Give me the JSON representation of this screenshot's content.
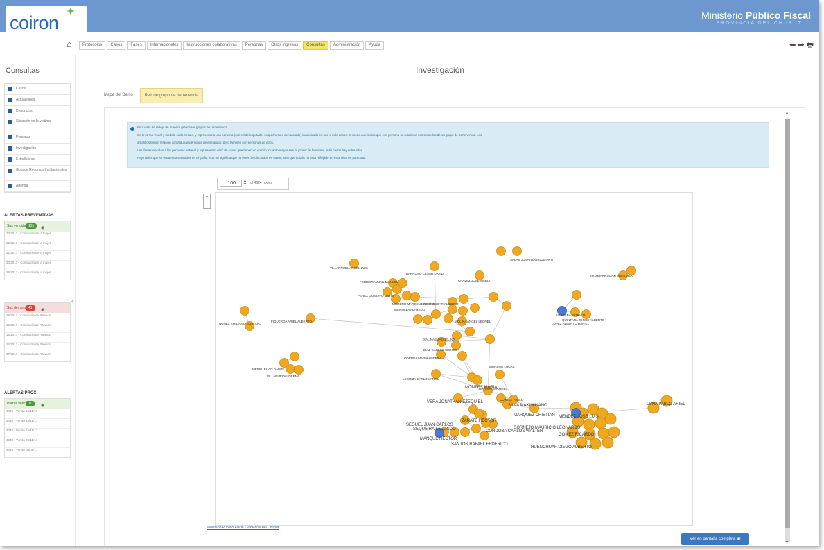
{
  "app": {
    "logo": "coiron",
    "ministry_prefix": "Ministerio ",
    "ministry_bold": "Público Fiscal",
    "ministry_sub": "PROVINCIA DEL CHUBUT"
  },
  "nav": {
    "menu": [
      "Protocolos",
      "Casos",
      "Fases",
      "Internacionales",
      "Instrucciones colaborativas",
      "Personas",
      "Otros ingresos",
      "Consultas",
      "Administración",
      "Ayuda"
    ],
    "active": "Consultas",
    "right_icons": "⬅ ➡ 🖶"
  },
  "sidebar": {
    "title": "Consultas",
    "items": [
      "Casos",
      "Actuaciones",
      "Denuncias",
      "Situación de la víctima",
      "Personas",
      "Investigación",
      "Estadísticas",
      "Guía de Recursos Institucionales",
      "Agenda"
    ],
    "alertas_title": "ALERTAS PREVENTIVAS",
    "sus_vencidas": {
      "label": "Sus vencidas",
      "count": "131"
    },
    "sus_vencidas_items": [
      "33/2017 - Comisaría de la mujer",
      "32/2017 - Comisaría de la mujer",
      "31/2017 - Comisaría de la mujer",
      "30/2017 - Comisaría de la mujer",
      "29/2017 - Comisaría de la mujer"
    ],
    "sus_demoradas": {
      "label": "Sus demoradas",
      "count": "41"
    },
    "sus_demoradas_items": [
      "28/2017 - Comisaría de Rawson",
      "15/2017 - Comisaría de Rawson",
      "15/2017 - Comisaría de Rawson",
      "14/2017 - Comisaría de Rawson",
      "07/2017 - Comisaría de Rawson"
    ],
    "alertas_prox": "ALERTAS PROX",
    "plazos": {
      "label": "Plazos vencidos",
      "count": "11"
    },
    "plazos_items": [
      "4409 - Vcmto 15/11/17",
      "4446 - Vcmto 15/11/17",
      "4346 - Vcmto 15/11/17",
      "4348 - Vcmto 08/11/17",
      "4385 - Vcmto 04/09/17"
    ]
  },
  "page": {
    "title": "Investigación",
    "tabs": [
      "Mapa del Delito",
      "Red de grupo de pertenencia"
    ],
    "active_tab": "Red de grupo de pertenencia"
  },
  "info": {
    "lines": [
      "Esta vista de refleja de manera gráfica los grupos de pertenencia.",
      "Se la forma visual y modela cada círculo, y representa a una persona (con rol de imputado, sospechoso o denunciado) involucrada en uno o más casos. El modo que indica que esa persona se relaciona con todos los de su grupo de pertenencia. Los",
      "amarillos tienen relación con algunas personas de ese grupo, pero también con personas de otros.",
      "Las líneas vinculan a las personas entre sí y representan el n° de casos que tienen en común. Cuanto mayor sea el grosor de la misma, más casos hay entre ellas.",
      "Hay nodos que se encuentran aislados en el grafo, esto no significa que no estén involucrados en casos, sino que quizás no está reflejado en esta vista en particular."
    ]
  },
  "graph": {
    "node_count": "100",
    "total_label": "of 4624 nodes",
    "credit": "Ministerio Público Fiscal - Provincia del Chubut",
    "fullscreen_button": "Ver en pantalla completa",
    "colors": {
      "primary": "#f0a820",
      "stroke": "#c88a10",
      "blue": "#4a78d6",
      "edge": "#c8c8c8"
    },
    "labels": [
      "SALAS JONATHAN GUSTAVO",
      "VILLARRUEL ANGEL LUIS",
      "BARROSO CESAR DAVID",
      "CHAVEZ JOSE MARIA",
      "ALVAREZ RAMON EDUARDO",
      "FERREIRA JUAN MANUEL",
      "PEREZ GUSTAVO DAVID",
      "MORENO MARCELO ADRIAN",
      "GOMEZ OSCAR ALBERTO",
      "VILLALBA PATRICIA",
      "QUINTANA JORGE ALBERTO",
      "MANSILLA ALFREDO",
      "NUÑEZ EMILIANO GUSTAVO",
      "FIGUEROA ARIEL ALBERTO",
      "LOPEZ ALBERTO DANIEL",
      "MOLINA ANGEL LEONEL",
      "DIAZ CARLOS SERGIO",
      "SALINAS JAQUELINE",
      "CORREA MARIA ANDREA",
      "LEGUIZA CARLOS ARIEL",
      "MEDEL ELVIO DANIEL",
      "MORENO LUCAS",
      "VILLANUEVA LORENA",
      "RODRIGUEZ ARIEL",
      "CORTEZ PABLO",
      "VERA JONATHAN EZEQUIEL",
      "SEGUEL JUAN CARLOS",
      "SILVA MAXIMILIANO",
      "ZARATE HECTOR",
      "CORDOBA CARLOS WALTER",
      "SEQUEIRA FACUNDO",
      "MANQUE HECTOR",
      "MARQUEZ CRISTIAN",
      "CORNEJO MAURICIO LEONARDO",
      "GOMEZ RICARDO",
      "HUENCHUAF DIEGO ALBERTO",
      "MONTES MARIA",
      "SANTOS RAFAEL FEDERICO",
      "MENDEZ JOSE LUIS",
      "LUNA PABLO ARIEL"
    ]
  }
}
